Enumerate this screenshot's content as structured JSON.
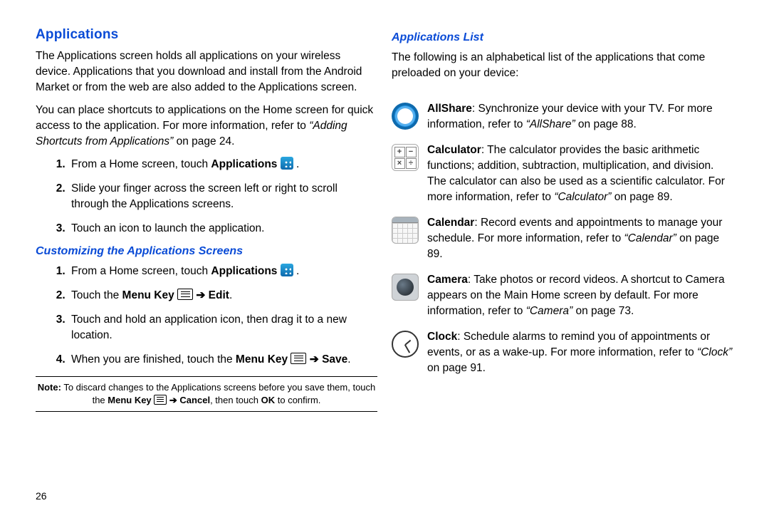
{
  "left": {
    "heading": "Applications",
    "para1": "The Applications screen holds all applications on your wireless device. Applications that you download and install from the Android Market or from the web are also added to the Applications screen.",
    "para2_a": "You can place shortcuts to applications on the Home screen for quick access to the application. For more information, refer to ",
    "para2_ref": "“Adding Shortcuts from Applications”",
    "para2_b": "  on page 24.",
    "list1": {
      "item1_a": "From a Home screen, touch ",
      "item1_b": "Applications",
      "item1_c": " .",
      "item2": "Slide your finger across the screen left or right to scroll through the Applications screens.",
      "item3": "Touch an icon to launch the application."
    },
    "subheading": "Customizing the Applications Screens",
    "list2": {
      "item1_a": "From a Home screen, touch ",
      "item1_b": "Applications",
      "item1_c": " .",
      "item2_a": "Touch the ",
      "item2_b": "Menu Key",
      "item2_arrow": " ➔ ",
      "item2_c": "Edit",
      "item2_d": ".",
      "item3": "Touch and hold an application icon, then drag it to a new location.",
      "item4_a": "When you are finished, touch the ",
      "item4_b": "Menu Key",
      "item4_arrow": "  ➔  ",
      "item4_c": "Save",
      "item4_d": "."
    },
    "note": {
      "label": "Note:",
      "text_a": "To discard changes to the Applications screens before you save them, touch the ",
      "text_b": "Menu Key",
      "arrow": " ➔ ",
      "text_c": "Cancel",
      "text_d": ", then touch ",
      "text_e": "OK",
      "text_f": " to confirm."
    }
  },
  "right": {
    "subheading": "Applications List",
    "intro": "The following is an alphabetical list of the applications that come preloaded on your device:",
    "apps": {
      "allshare": {
        "name": "AllShare",
        "desc_a": ": Synchronize your device with your TV. For more information, refer to ",
        "ref": "“AllShare”",
        "desc_b": "  on page 88."
      },
      "calculator": {
        "name": "Calculator",
        "desc_a": ": The calculator provides the basic arithmetic functions; addition, subtraction, multiplication, and division. The calculator can also be used as a scientific calculator. For more information, refer to ",
        "ref": "“Calculator”",
        "desc_b": "  on page 89."
      },
      "calendar": {
        "name": "Calendar",
        "desc_a": ": Record events and appointments to manage your schedule. For more information, refer to ",
        "ref": "“Calendar”",
        "desc_b": "  on page 89."
      },
      "camera": {
        "name": "Camera",
        "desc_a": ": Take photos or record videos. A shortcut to Camera appears on the Main Home screen by default. For more information, refer to ",
        "ref": "“Camera”",
        "desc_b": "  on page 73."
      },
      "clock": {
        "name": "Clock",
        "desc_a": ": Schedule alarms to remind you of appointments or events, or as a wake-up. For more information, refer to ",
        "ref": "“Clock”",
        "desc_b": "  on page 91."
      }
    }
  },
  "page_number": "26"
}
